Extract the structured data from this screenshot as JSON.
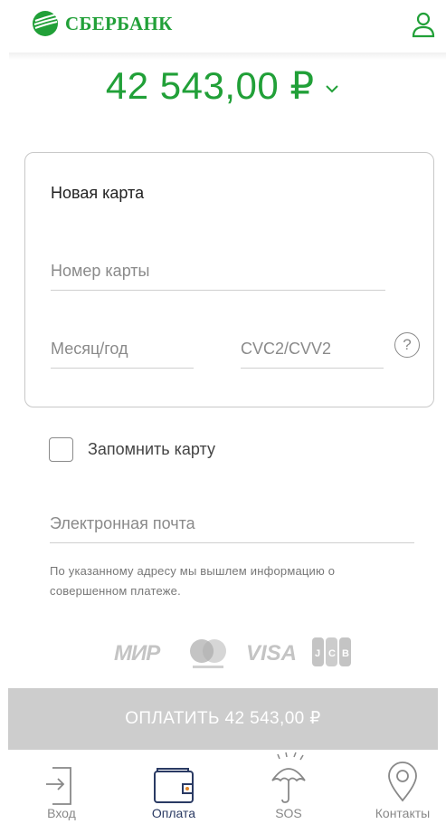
{
  "header": {
    "bank_name": "СБЕРБАНК",
    "logo_icon": "sberbank-logo-icon",
    "profile_icon": "user-profile-icon",
    "brand_color": "#21a038"
  },
  "amount": {
    "value": "42 543,00 ₽",
    "chevron_icon": "chevron-down-icon"
  },
  "card_form": {
    "title": "Новая карта",
    "card_number_placeholder": "Номер карты",
    "expiry_placeholder": "Месяц/год",
    "cvc_placeholder": "CVC2/CVV2",
    "help_symbol": "?"
  },
  "remember": {
    "label": "Запомнить карту",
    "checked": false
  },
  "email": {
    "placeholder": "Электронная почта"
  },
  "notice": "По указанному адресу мы вышлем информацию о совершенном платеже.",
  "payment_systems": {
    "mir": "МИР",
    "mastercard_icon": "mastercard-logo-icon",
    "visa": "VISA",
    "jcb_icon": "jcb-logo-icon"
  },
  "pay_button": {
    "label": "ОПЛАТИТЬ 42 543,00 ₽",
    "color": "#cdcdcd"
  },
  "tabs": [
    {
      "label": "Вход",
      "icon": "login-icon",
      "active": false
    },
    {
      "label": "Оплата",
      "icon": "wallet-icon",
      "active": true
    },
    {
      "label": "SOS",
      "icon": "umbrella-icon",
      "active": false
    },
    {
      "label": "Контакты",
      "icon": "location-pin-icon",
      "active": false
    }
  ],
  "active_tab_color": "#2a3a63"
}
